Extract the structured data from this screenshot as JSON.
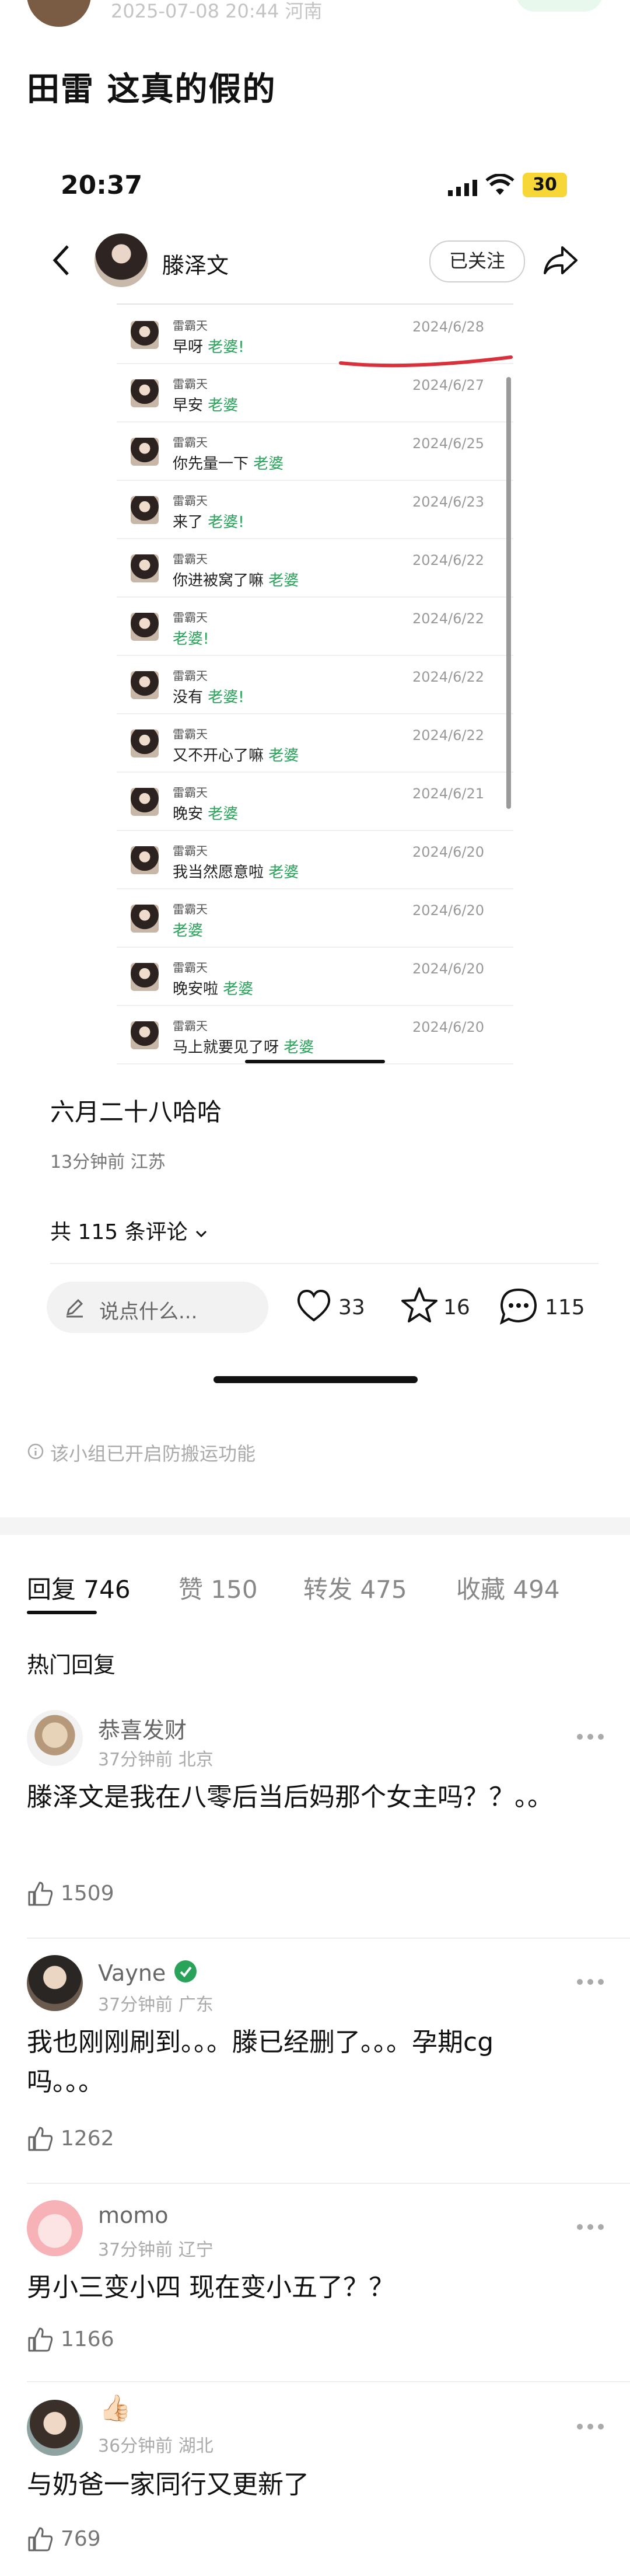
{
  "top": {
    "meta": "2025-07-08 20:44 河南",
    "title": "田雷 这真的假的"
  },
  "screenshot": {
    "status_time": "20:37",
    "battery": "30",
    "profile_name": "滕泽文",
    "follow_state": "已关注",
    "chat": [
      {
        "sender": "雷霸天",
        "text": "早呀",
        "hl": "老婆!",
        "date": "2024/6/28"
      },
      {
        "sender": "雷霸天",
        "text": "早安",
        "hl": "老婆",
        "date": "2024/6/27"
      },
      {
        "sender": "雷霸天",
        "text": "你先量一下",
        "hl": "老婆",
        "date": "2024/6/25"
      },
      {
        "sender": "雷霸天",
        "text": "来了",
        "hl": "老婆!",
        "date": "2024/6/23"
      },
      {
        "sender": "雷霸天",
        "text": "你进被窝了嘛",
        "hl": "老婆",
        "date": "2024/6/22"
      },
      {
        "sender": "雷霸天",
        "text": "",
        "hl": "老婆!",
        "date": "2024/6/22"
      },
      {
        "sender": "雷霸天",
        "text": "没有",
        "hl": "老婆!",
        "date": "2024/6/22"
      },
      {
        "sender": "雷霸天",
        "text": "又不开心了嘛",
        "hl": "老婆",
        "date": "2024/6/22"
      },
      {
        "sender": "雷霸天",
        "text": "晚安",
        "hl": "老婆",
        "date": "2024/6/21"
      },
      {
        "sender": "雷霸天",
        "text": "我当然愿意啦",
        "hl": "老婆",
        "date": "2024/6/20"
      },
      {
        "sender": "雷霸天",
        "text": "",
        "hl": "老婆",
        "date": "2024/6/20"
      },
      {
        "sender": "雷霸天",
        "text": "晚安啦",
        "hl": "老婆",
        "date": "2024/6/20"
      },
      {
        "sender": "雷霸天",
        "text": "马上就要见了呀",
        "hl": "老婆",
        "date": "2024/6/20"
      }
    ],
    "caption": "六月二十八哈哈",
    "caption_meta": "13分钟前 江苏",
    "comments_total": "共 115 条评论",
    "input_placeholder": "说点什么...",
    "likes": "33",
    "stars": "16",
    "comments": "115"
  },
  "notice": "该小组已开启防搬运功能",
  "tabs": [
    {
      "label": "回复",
      "count": "746"
    },
    {
      "label": "赞",
      "count": "150"
    },
    {
      "label": "转发",
      "count": "475"
    },
    {
      "label": "收藏",
      "count": "494"
    }
  ],
  "hot_label": "热门回复",
  "comments": [
    {
      "name": "恭喜发财",
      "meta": "37分钟前 北京",
      "text": "滕泽文是我在八零后当后妈那个女主吗？？。。",
      "likes": "1509"
    },
    {
      "name": "Vayne",
      "meta": "37分钟前 广东",
      "text": "我也刚刚刷到。。。滕已经删了。。。孕期cg吗。。。",
      "likes": "1262"
    },
    {
      "name": "momo",
      "meta": "37分钟前 辽宁",
      "text": "男小三变小四 现在变小五了？？",
      "likes": "1166"
    },
    {
      "name": "",
      "meta": "36分钟前 湖北",
      "text": "与奶爸一家同行又更新了",
      "likes": "769"
    }
  ]
}
